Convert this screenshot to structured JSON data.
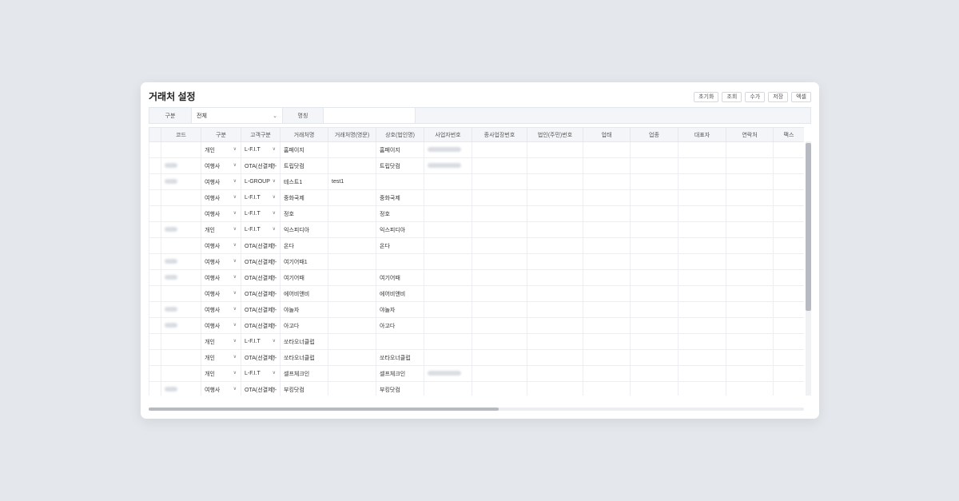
{
  "page_title": "거래처 설정",
  "toolbar": {
    "reset": "초기화",
    "search": "조회",
    "add": "수가",
    "save": "저장",
    "excel": "엑셀"
  },
  "filter": {
    "type_label": "구분",
    "type_value": "전체",
    "name_label": "명칭",
    "name_value": ""
  },
  "columns": [
    "코드",
    "구분",
    "고객구분",
    "거래처명",
    "거래처명(영문)",
    "상호(법인명)",
    "사업자번호",
    "종사업장번호",
    "법인(주민)번호",
    "업태",
    "업종",
    "대표자",
    "연락처",
    "팩스"
  ],
  "rows": [
    {
      "code_masked": false,
      "type": "개인",
      "cust": "L-F.I.T",
      "name": "홈페이지",
      "name_en": "",
      "corp": "홈페이지",
      "biz_masked": true
    },
    {
      "code_masked": true,
      "type": "여행사",
      "cust": "OTA(선결제)-",
      "name": "트립닷컴",
      "name_en": "",
      "corp": "트립닷컴",
      "biz_masked": true
    },
    {
      "code_masked": true,
      "type": "여행사",
      "cust": "L-GROUP",
      "name": "테스트1",
      "name_en": "test1",
      "corp": "",
      "biz_masked": false
    },
    {
      "code_masked": false,
      "type": "여행사",
      "cust": "L-F.I.T",
      "name": "중화국제",
      "name_en": "",
      "corp": "중화국제",
      "biz_masked": false
    },
    {
      "code_masked": false,
      "type": "여행사",
      "cust": "L-F.I.T",
      "name": "정호",
      "name_en": "",
      "corp": "정호",
      "biz_masked": false
    },
    {
      "code_masked": true,
      "type": "개인",
      "cust": "L-F.I.T",
      "name": "익스피디아",
      "name_en": "",
      "corp": "익스피디아",
      "biz_masked": false
    },
    {
      "code_masked": false,
      "type": "여행사",
      "cust": "OTA(선결제)-",
      "name": "온다",
      "name_en": "",
      "corp": "온다",
      "biz_masked": false
    },
    {
      "code_masked": true,
      "type": "여행사",
      "cust": "OTA(선결제)-",
      "name": "여기어때1",
      "name_en": "",
      "corp": "",
      "biz_masked": false
    },
    {
      "code_masked": true,
      "type": "여행사",
      "cust": "OTA(선결제)-",
      "name": "여기어때",
      "name_en": "",
      "corp": "여기어때",
      "biz_masked": false
    },
    {
      "code_masked": false,
      "type": "여행사",
      "cust": "OTA(선결제)-",
      "name": "에어비앤비",
      "name_en": "",
      "corp": "에어비앤비",
      "biz_masked": false
    },
    {
      "code_masked": true,
      "type": "여행사",
      "cust": "OTA(선결제)-",
      "name": "야놀자",
      "name_en": "",
      "corp": "야놀자",
      "biz_masked": false
    },
    {
      "code_masked": true,
      "type": "여행사",
      "cust": "OTA(선결제)-",
      "name": "아고다",
      "name_en": "",
      "corp": "아고다",
      "biz_masked": false
    },
    {
      "code_masked": false,
      "type": "개인",
      "cust": "L-F.I.T",
      "name": "쏘타오너클럽",
      "name_en": "",
      "corp": "",
      "biz_masked": false
    },
    {
      "code_masked": false,
      "type": "개인",
      "cust": "OTA(선결제)-",
      "name": "쏘타오너클럽",
      "name_en": "",
      "corp": "쏘타오너클럽",
      "biz_masked": false
    },
    {
      "code_masked": false,
      "type": "개인",
      "cust": "L-F.I.T",
      "name": "셀프체크인",
      "name_en": "",
      "corp": "셀프체크인",
      "biz_masked": true
    },
    {
      "code_masked": true,
      "type": "여행사",
      "cust": "OTA(선결제)-",
      "name": "부킹닷컴",
      "name_en": "",
      "corp": "부킹닷컴",
      "biz_masked": false
    }
  ]
}
